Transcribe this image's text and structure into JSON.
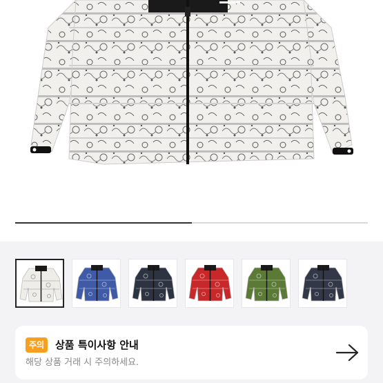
{
  "gallery": {
    "progress": 0.5,
    "selected_index": 0,
    "thumbnails": [
      {
        "name": "white-bandana-jacket",
        "color": "#ffffff"
      },
      {
        "name": "blue-bandana-jacket",
        "color": "#3f5aa6"
      },
      {
        "name": "black-bandana-jacket",
        "color": "#2d3340"
      },
      {
        "name": "red-bandana-jacket",
        "color": "#c8282a"
      },
      {
        "name": "camo-bandana-jacket",
        "color": "#5b7a35"
      },
      {
        "name": "navy-bandana-jacket",
        "color": "#323848"
      }
    ]
  },
  "notice": {
    "badge": "주의",
    "title": "상품 특이사항 안내",
    "subtitle": "해당 상품 거래 시 주의하세요.",
    "arrow_icon": "arrow-right-icon"
  }
}
